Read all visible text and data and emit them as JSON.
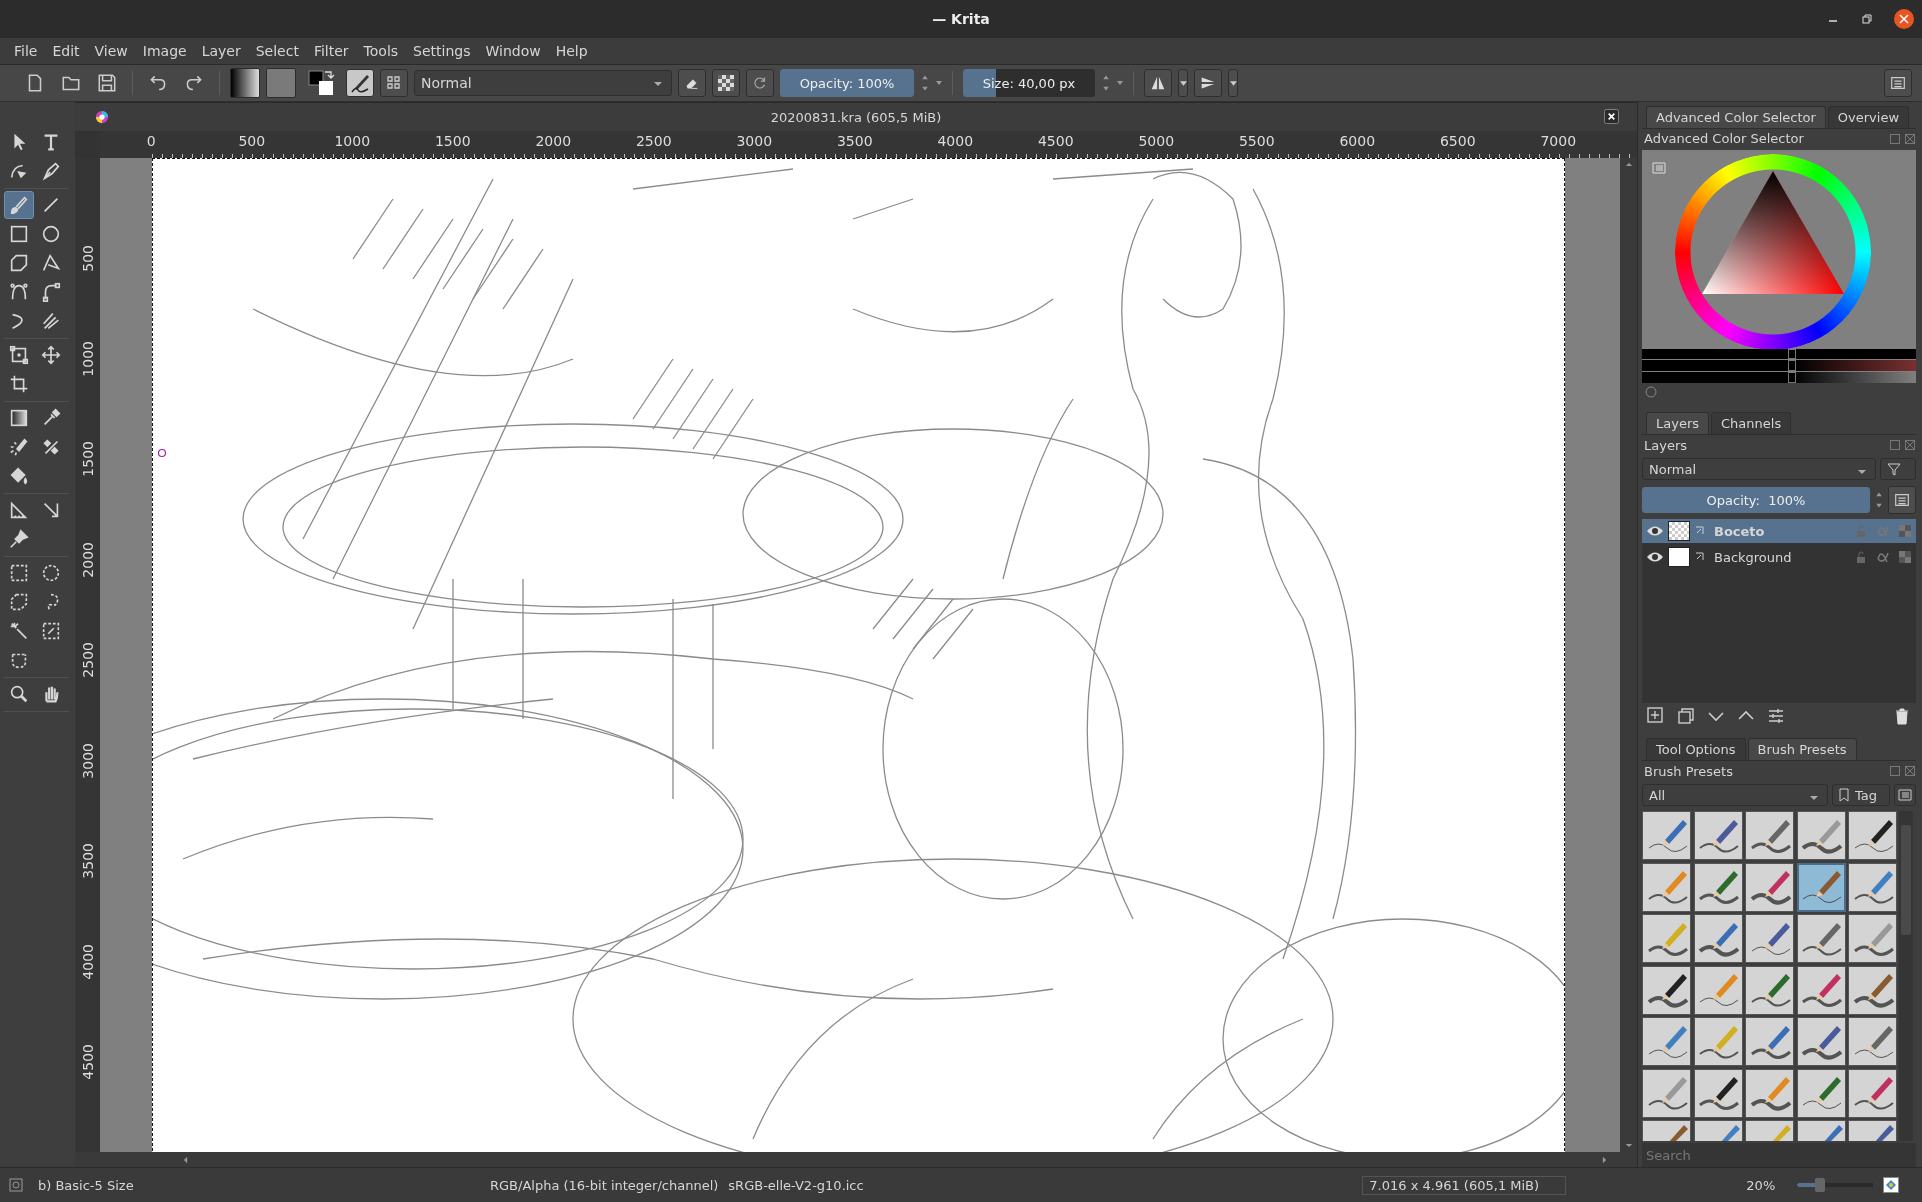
{
  "window": {
    "title": "— Krita"
  },
  "menu": [
    "File",
    "Edit",
    "View",
    "Image",
    "Layer",
    "Select",
    "Filter",
    "Tools",
    "Settings",
    "Window",
    "Help"
  ],
  "toolbar": {
    "blend_mode": "Normal",
    "opacity": {
      "label": "Opacity: 100%",
      "level": 1
    },
    "size": {
      "label": "Size: 40,00 px",
      "level": 0.25
    }
  },
  "document": {
    "title": "20200831.kra (605,5 MiB)",
    "top_ruler": [
      "0",
      "500",
      "1000",
      "1500",
      "2000",
      "2500",
      "3000",
      "3500",
      "4000",
      "4500",
      "5000",
      "5500",
      "6000",
      "6500",
      "7000"
    ],
    "left_ruler": [
      "500",
      "1000",
      "1500",
      "2000",
      "2500",
      "3000",
      "3500",
      "4000",
      "4500"
    ]
  },
  "tools": [
    {
      "selected": false
    },
    {
      "selected": false
    },
    {
      "selected": false
    },
    {
      "selected": false
    },
    {
      "selected": true
    },
    {
      "selected": false
    },
    {
      "selected": false
    },
    {
      "selected": false
    },
    {
      "selected": false
    },
    {
      "selected": false
    },
    {
      "selected": false
    },
    {
      "selected": false
    },
    {
      "selected": false
    },
    {
      "selected": false
    },
    {
      "selected": false
    },
    {
      "selected": false
    },
    {
      "selected": false
    },
    {
      "selected": false
    },
    {
      "selected": false
    },
    {
      "selected": false
    },
    {
      "selected": false
    },
    {
      "selected": false
    },
    {
      "selected": false
    },
    {
      "selected": false
    },
    {
      "selected": false
    },
    {
      "selected": false
    },
    {
      "selected": false
    },
    {
      "selected": false
    },
    {
      "selected": false
    },
    {
      "selected": false
    },
    {
      "selected": false
    },
    {
      "selected": false
    },
    {
      "selected": false
    },
    {
      "selected": false
    }
  ],
  "color_docker": {
    "tabs": [
      {
        "label": "Advanced Color Selector",
        "selected": true
      },
      {
        "label": "Overview",
        "selected": false
      }
    ],
    "title": "Advanced Color Selector",
    "sliders": [
      {
        "level": 0.55
      },
      {
        "level": 0.55
      },
      {
        "level": 0.55
      }
    ]
  },
  "layers_docker": {
    "tabs": [
      {
        "label": "Layers",
        "selected": true
      },
      {
        "label": "Channels",
        "selected": false
      }
    ],
    "title": "Layers",
    "blend_mode": "Normal",
    "opacity": {
      "label": "Opacity:  100%",
      "level": 1
    },
    "layers": [
      {
        "name": "Boceto",
        "selected": true,
        "visible": true,
        "kind": "transparent"
      },
      {
        "name": "Background",
        "selected": false,
        "visible": true,
        "kind": "white"
      }
    ]
  },
  "brush_docker": {
    "tabs": [
      {
        "label": "Tool Options",
        "selected": false
      },
      {
        "label": "Brush Presets",
        "selected": true
      }
    ],
    "title": "Brush Presets",
    "filter": "All",
    "tag_button": "Tag",
    "presets": [
      {
        "selected": false
      },
      {
        "selected": false
      },
      {
        "selected": false
      },
      {
        "selected": false
      },
      {
        "selected": false
      },
      {
        "selected": false
      },
      {
        "selected": false
      },
      {
        "selected": false
      },
      {
        "selected": true
      },
      {
        "selected": false
      },
      {
        "selected": false
      },
      {
        "selected": false
      },
      {
        "selected": false
      },
      {
        "selected": false
      },
      {
        "selected": false
      },
      {
        "selected": false
      },
      {
        "selected": false
      },
      {
        "selected": false
      },
      {
        "selected": false
      },
      {
        "selected": false
      },
      {
        "selected": false
      },
      {
        "selected": false
      },
      {
        "selected": false
      },
      {
        "selected": false
      },
      {
        "selected": false
      },
      {
        "selected": false
      },
      {
        "selected": false
      },
      {
        "selected": false
      },
      {
        "selected": false
      },
      {
        "selected": false
      },
      {
        "selected": false
      },
      {
        "selected": false
      },
      {
        "selected": false
      },
      {
        "selected": false
      },
      {
        "selected": false
      }
    ],
    "search": {
      "placeholder": "Search"
    }
  },
  "status_bar": {
    "brush": "b) Basic-5 Size",
    "color_model": "RGB/Alpha (16-bit integer/channel)",
    "profile": "sRGB-elle-V2-g10.icc",
    "image_size": "7.016 x 4.961 (605,1 MiB)",
    "zoom": "20%",
    "zoom_slider": {
      "level": 0.3
    }
  }
}
